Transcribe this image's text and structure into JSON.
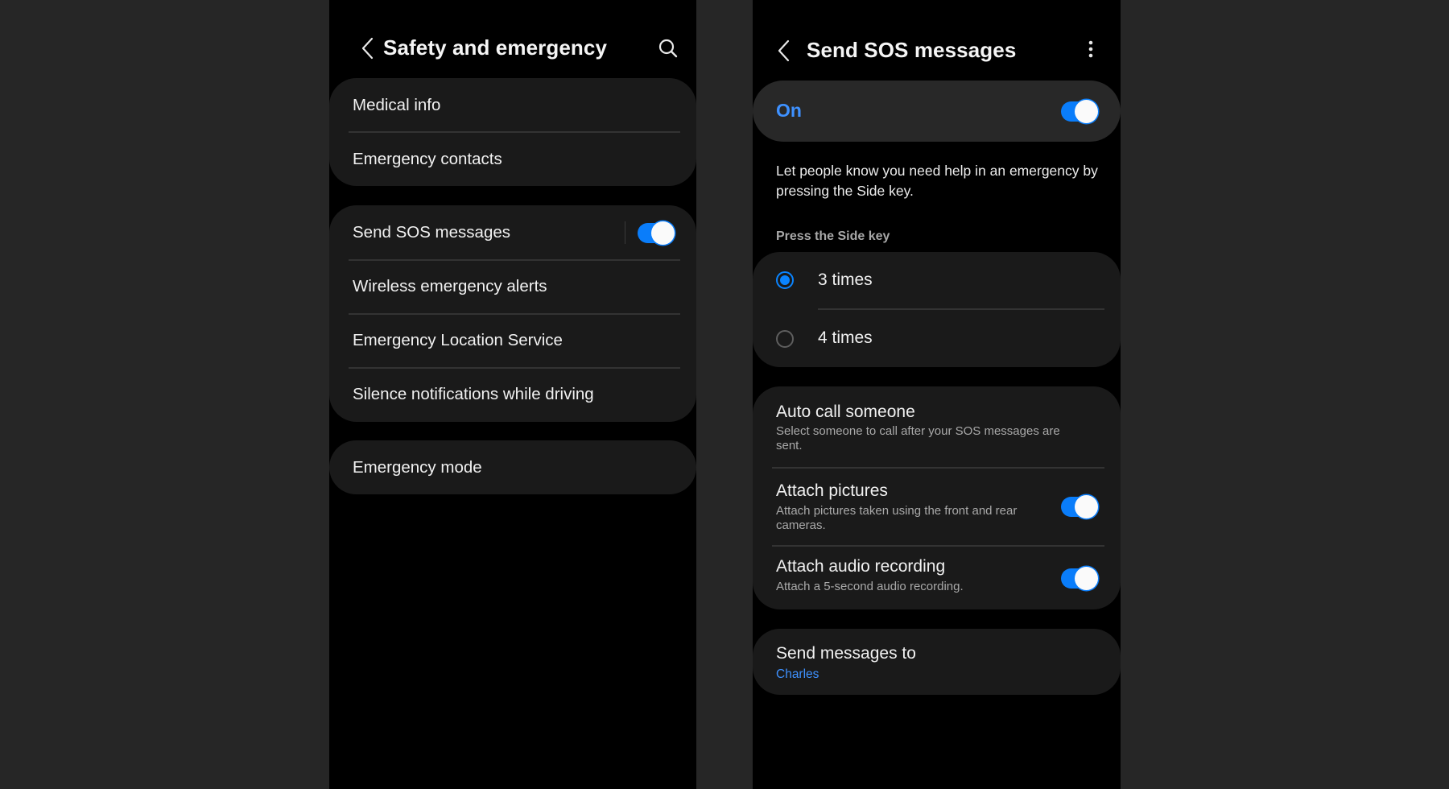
{
  "left_screen": {
    "title": "Safety and emergency",
    "back_icon": "chevron-left-icon",
    "search_icon": "search-icon",
    "groups": [
      {
        "items": [
          {
            "label": "Medical info"
          },
          {
            "label": "Emergency contacts"
          }
        ]
      },
      {
        "items": [
          {
            "label": "Send SOS messages",
            "toggle": true,
            "toggle_on": true
          },
          {
            "label": "Wireless emergency alerts"
          },
          {
            "label": "Emergency Location Service"
          },
          {
            "label": "Silence notifications while driving"
          }
        ]
      },
      {
        "items": [
          {
            "label": "Emergency mode"
          }
        ]
      }
    ]
  },
  "right_screen": {
    "title": "Send SOS messages",
    "back_icon": "chevron-left-icon",
    "more_icon": "more-vertical-icon",
    "master_switch": {
      "label": "On",
      "on": true
    },
    "description": "Let people know you need help in an emergency by pressing the Side key.",
    "press_section": {
      "header": "Press the Side key",
      "options": [
        {
          "label": "3 times",
          "selected": true
        },
        {
          "label": "4 times",
          "selected": false
        }
      ]
    },
    "options_group": [
      {
        "title": "Auto call someone",
        "subtitle": "Select someone to call after your SOS messages are sent."
      },
      {
        "title": "Attach pictures",
        "subtitle": "Attach pictures taken using the front and rear cameras.",
        "toggle_on": true
      },
      {
        "title": "Attach audio recording",
        "subtitle": "Attach a 5-second audio recording.",
        "toggle_on": true
      }
    ],
    "recipients": {
      "title": "Send messages to",
      "value": "Charles"
    }
  },
  "colors": {
    "accent": "#0a84ff",
    "accent_text": "#3e91ff",
    "card": "#1a1a1a",
    "switch_card": "#282828",
    "screen_bg": "#000000",
    "page_bg": "#262626"
  }
}
